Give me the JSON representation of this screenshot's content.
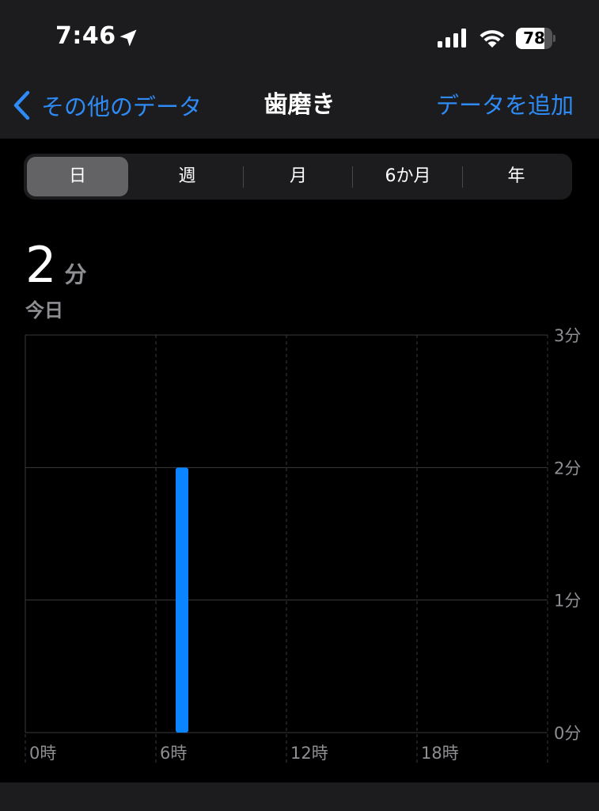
{
  "status_bar": {
    "time": "7:46",
    "battery_level": "78",
    "battery_fraction": 0.78
  },
  "nav": {
    "back_label": "その他のデータ",
    "title": "歯磨き",
    "add_label": "データを追加"
  },
  "segments": {
    "items": [
      "日",
      "週",
      "月",
      "6か月",
      "年"
    ],
    "selected": "日"
  },
  "summary": {
    "value": "2",
    "unit": "分",
    "period": "今日"
  },
  "colors": {
    "accent": "#2e8bf5",
    "bar": "#0a84ff",
    "background": "#000000",
    "surface": "#1c1c1e"
  },
  "chart_data": {
    "type": "bar",
    "x": [
      "6時"
    ],
    "values": [
      2
    ],
    "x_ticks": [
      {
        "value": 0,
        "label": "0時"
      },
      {
        "value": 6,
        "label": "6時"
      },
      {
        "value": 12,
        "label": "12時"
      },
      {
        "value": 18,
        "label": "18時"
      }
    ],
    "xlim": [
      0,
      24
    ],
    "bar_hour": 7,
    "y_ticks": [
      {
        "value": 0,
        "label": "0分"
      },
      {
        "value": 1,
        "label": "1分"
      },
      {
        "value": 2,
        "label": "2分"
      },
      {
        "value": 3,
        "label": "3分"
      }
    ],
    "ylim": [
      0,
      3
    ],
    "grid": true
  }
}
